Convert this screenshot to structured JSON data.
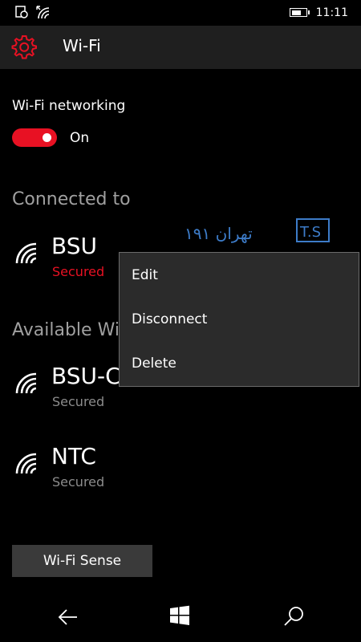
{
  "status_bar": {
    "time": "11:11",
    "icons": [
      "notification-icon",
      "wifi-signal-icon",
      "battery-icon"
    ],
    "battery_level": 0.7
  },
  "app_bar": {
    "title": "Wi-Fi",
    "icon": "gear-icon"
  },
  "wifi_networking": {
    "label": "Wi-Fi networking",
    "toggle_state": "On",
    "on": true
  },
  "connected": {
    "header": "Connected to",
    "network": {
      "name": "BSU",
      "status": "Secured"
    }
  },
  "available": {
    "header": "Available Wi-",
    "networks": [
      {
        "name": "BSU-C",
        "status": "Secured"
      },
      {
        "name": "NTC",
        "status": "Secured"
      }
    ]
  },
  "watermark": {
    "logo_text": "T.S",
    "script_text": "تهران ۱۹۱"
  },
  "context_menu": {
    "items": [
      "Edit",
      "Disconnect",
      "Delete"
    ]
  },
  "wifi_sense_button": "Wi-Fi Sense",
  "nav_bar": {
    "icons": [
      "back-icon",
      "windows-start-icon",
      "search-icon"
    ]
  },
  "colors": {
    "accent": "#e81123",
    "background": "#000000",
    "app_bar": "#1f1f1f",
    "menu_bg": "#2b2b2b",
    "secondary_text": "#8c8c8c"
  }
}
